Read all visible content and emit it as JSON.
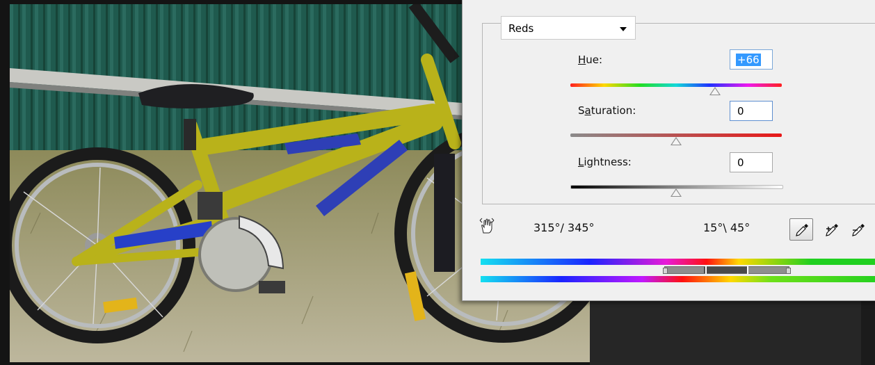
{
  "dialog": {
    "channel": {
      "selected": "Reds"
    },
    "hue": {
      "label_pre": "",
      "label_key": "H",
      "label_post": "ue:",
      "value": "+66",
      "level": 66,
      "range": [
        -180,
        180
      ]
    },
    "saturation": {
      "label_pre": "S",
      "label_key": "a",
      "label_post": "turation:",
      "value": "0",
      "level": 0,
      "range": [
        -100,
        100
      ]
    },
    "lightness": {
      "label_pre": "",
      "label_key": "L",
      "label_post": "ightness:",
      "value": "0",
      "level": 0,
      "range": [
        -100,
        100
      ]
    },
    "range_left": "315°/ 345°",
    "range_right": "15°\\ 45°",
    "tools": {
      "hand": "hand-adjust-icon",
      "eyedropper": "eyedropper-icon",
      "eyedropper_add": "eyedropper-plus-icon",
      "eyedropper_subtract": "eyedropper-minus-icon"
    }
  },
  "colors": {
    "dialog_bg": "#f0f0f0",
    "selection": "#3399ff",
    "canvas_bg": "#232323"
  }
}
